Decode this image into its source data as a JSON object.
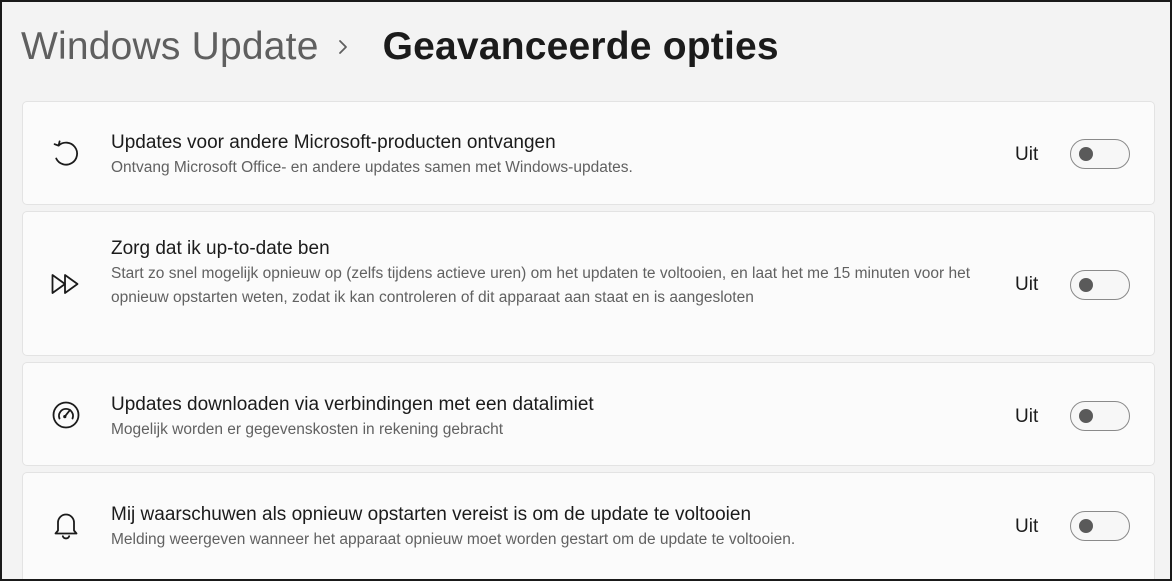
{
  "breadcrumb": {
    "parent": "Windows Update",
    "separator_icon": "chevron-right-icon",
    "current": "Geavanceerde opties"
  },
  "settings": [
    {
      "icon": "refresh-icon",
      "title": "Updates voor andere Microsoft-producten ontvangen",
      "description": "Ontvang Microsoft Office- en andere updates samen met Windows-updates.",
      "state_label": "Uit",
      "enabled": false
    },
    {
      "icon": "fast-forward-icon",
      "title": "Zorg dat ik up-to-date ben",
      "description": "Start zo snel mogelijk opnieuw op (zelfs tijdens actieve uren) om het updaten te voltooien, en laat het me 15 minuten voor het opnieuw opstarten weten, zodat ik kan controleren of dit apparaat aan staat en is aangesloten",
      "state_label": "Uit",
      "enabled": false
    },
    {
      "icon": "speedometer-icon",
      "title": "Updates downloaden via verbindingen met een datalimiet",
      "description": "Mogelijk worden er gegevenskosten in rekening gebracht",
      "state_label": "Uit",
      "enabled": false
    },
    {
      "icon": "bell-icon",
      "title": "Mij waarschuwen als opnieuw opstarten vereist is om de update te voltooien",
      "description": "Melding weergeven wanneer het apparaat opnieuw moet worden gestart om de update te voltooien.",
      "state_label": "Uit",
      "enabled": false
    }
  ]
}
